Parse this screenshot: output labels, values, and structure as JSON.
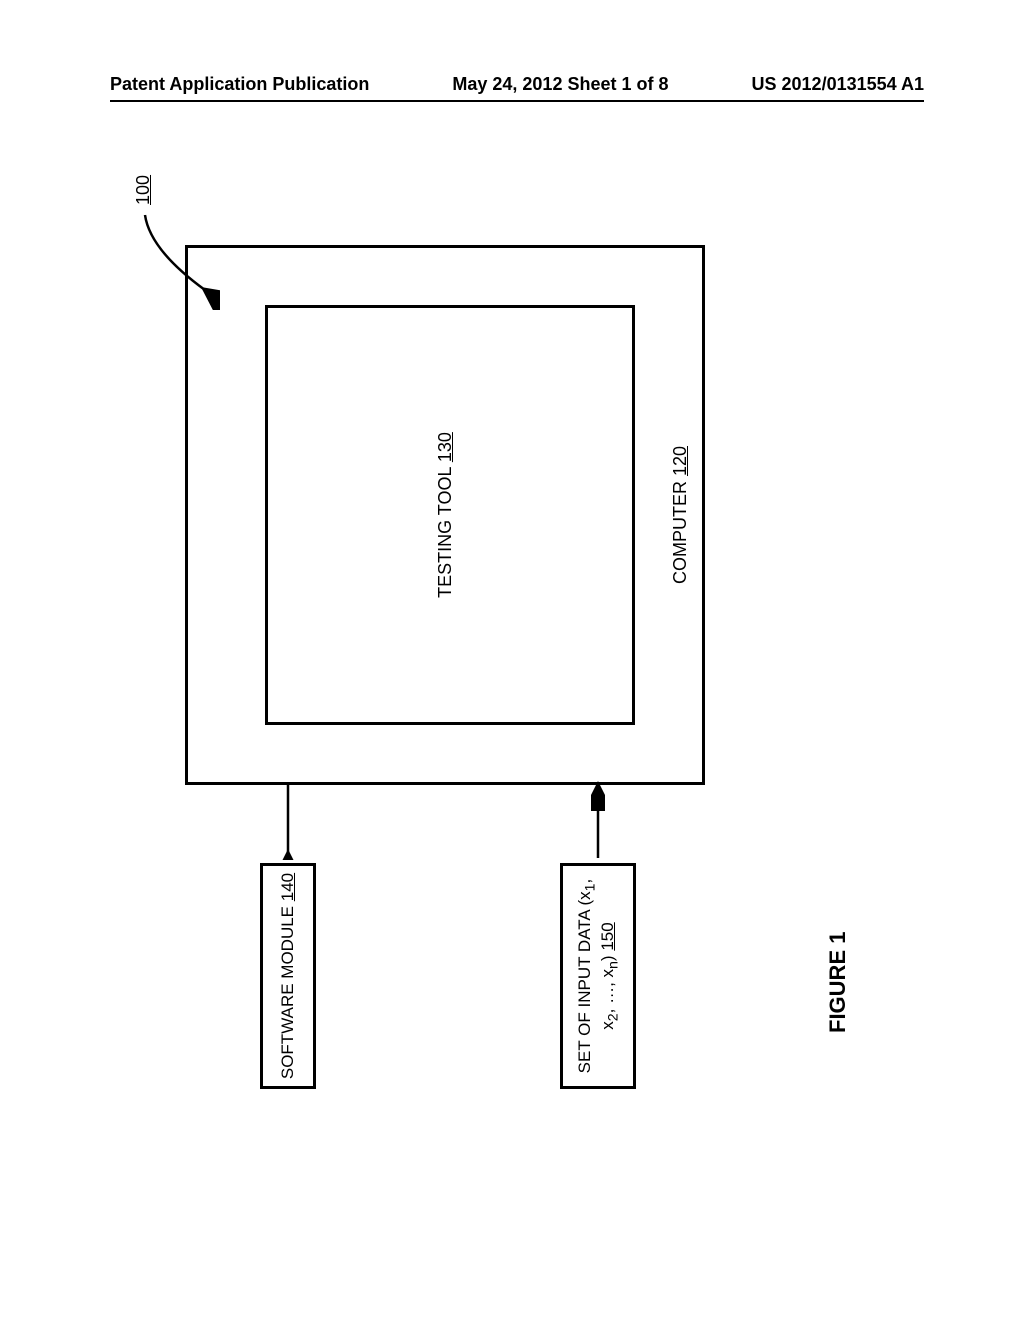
{
  "header": {
    "left": "Patent Application Publication",
    "center": "May 24, 2012  Sheet 1 of 8",
    "right": "US 2012/0131554 A1"
  },
  "figure": {
    "label": "FIGURE 1",
    "ref_main": "100",
    "computer": {
      "text": "COMPUTER ",
      "ref": "120"
    },
    "testing_tool": {
      "text": "TESTING TOOL ",
      "ref": "130"
    },
    "software_module": {
      "text": "SOFTWARE MODULE ",
      "ref": "140"
    },
    "input_data": {
      "prefix": "SET OF INPUT DATA (x",
      "seq": ", x",
      "cont": ", …, x",
      "close": ") ",
      "ref": "150"
    }
  }
}
